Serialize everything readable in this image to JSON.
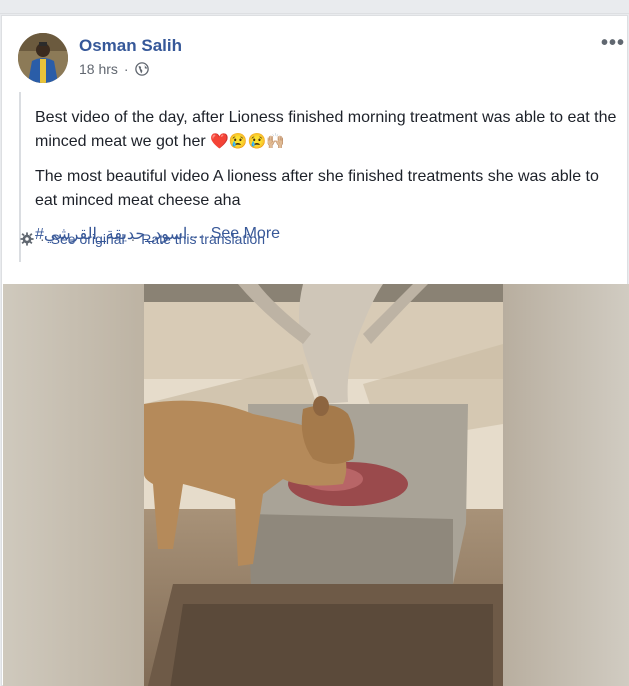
{
  "post": {
    "author": "Osman Salih",
    "timestamp": "18 hrs",
    "visibility_icon": "globe-icon",
    "menu_label": "•••",
    "text_original": "Best video of the day, after Lioness finished morning treatment was able to eat the minced meat we got her",
    "emojis": "❤️😢😢🙌🏼",
    "text_translation": "The most beautiful video A lioness after she finished treatments she was able to eat minced meat cheese aha",
    "hashtag": "#اسود_حديقة_القرشي",
    "ellipsis": "...",
    "see_more": "See More",
    "translation_bar": {
      "icon": "gear-icon",
      "see_original": "See original",
      "separator": "·",
      "rate": "Rate this translation"
    }
  },
  "media": {
    "type": "video",
    "subject": "lioness-eating-minced-meat"
  },
  "colors": {
    "link": "#365899",
    "text": "#1d2129",
    "meta": "#616770",
    "background": "#e9ebee"
  }
}
